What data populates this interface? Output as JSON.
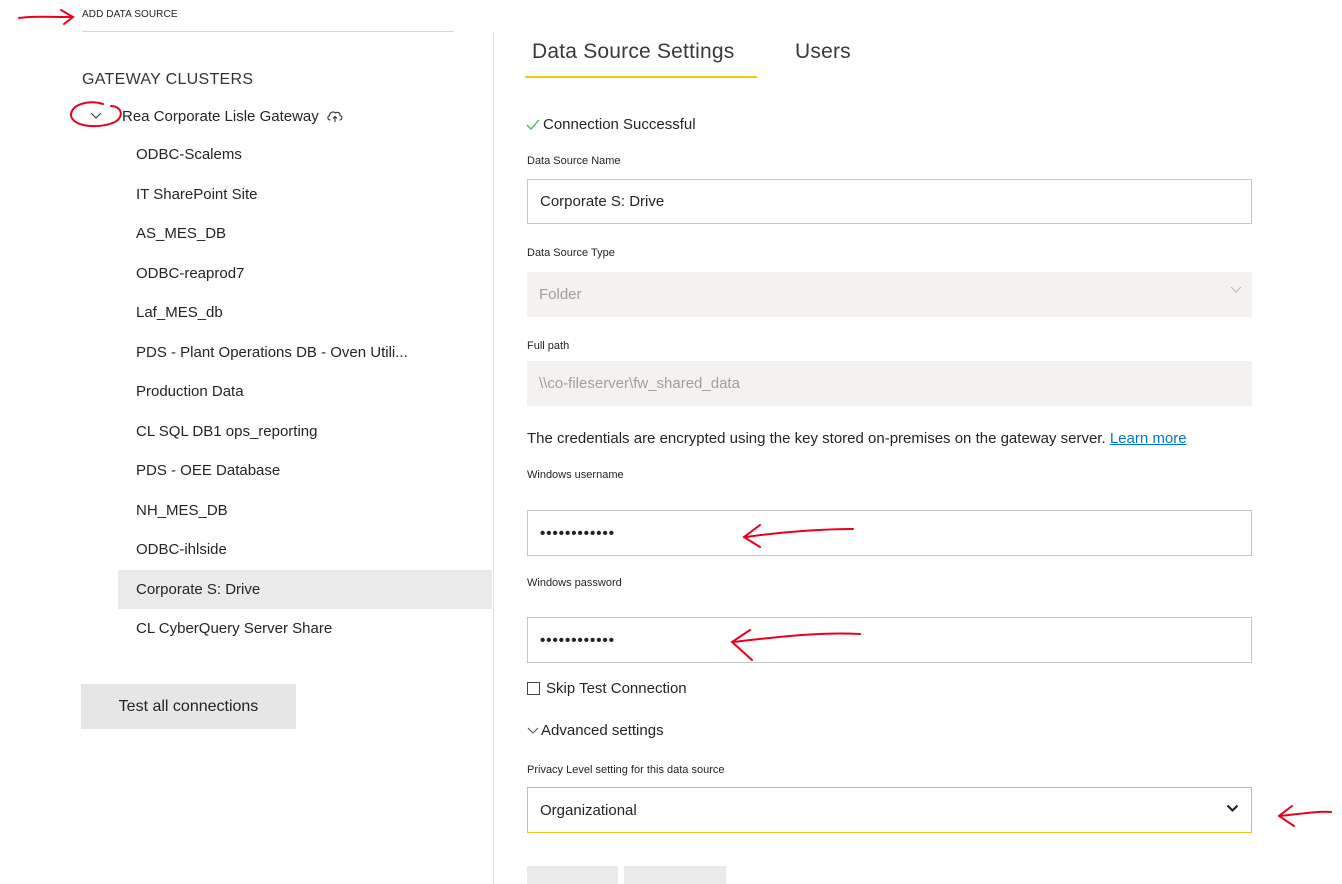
{
  "header": {
    "add_data_source": "ADD DATA SOURCE"
  },
  "sidebar": {
    "heading": "GATEWAY CLUSTERS",
    "cluster_name": "Rea Corporate Lisle Gateway",
    "items": [
      {
        "label": "ODBC-Scalems"
      },
      {
        "label": "IT SharePoint Site"
      },
      {
        "label": "AS_MES_DB"
      },
      {
        "label": "ODBC-reaprod7"
      },
      {
        "label": "Laf_MES_db"
      },
      {
        "label": "PDS - Plant Operations DB - Oven Utili..."
      },
      {
        "label": "Production Data"
      },
      {
        "label": "CL SQL DB1 ops_reporting"
      },
      {
        "label": "PDS - OEE Database"
      },
      {
        "label": "NH_MES_DB"
      },
      {
        "label": "ODBC-ihlside"
      },
      {
        "label": "Corporate S: Drive",
        "selected": true
      },
      {
        "label": "CL CyberQuery Server Share"
      }
    ],
    "test_all_label": "Test all connections"
  },
  "tabs": [
    {
      "label": "Data Source Settings",
      "active": true
    },
    {
      "label": "Users",
      "active": false
    }
  ],
  "form": {
    "connection_status": "Connection Successful",
    "ds_name_label": "Data Source Name",
    "ds_name_value": "Corporate S: Drive",
    "ds_type_label": "Data Source Type",
    "ds_type_value": "Folder",
    "full_path_label": "Full path",
    "full_path_value": "\\\\co-fileserver\\fw_shared_data",
    "credentials_note": "The credentials are encrypted using the key stored on-premises on the gateway server.",
    "learn_more": "Learn more",
    "username_label": "Windows username",
    "username_value": "••••••••••••",
    "password_label": "Windows password",
    "password_value": "••••••••••••",
    "skip_test_label": "Skip Test Connection",
    "advanced_label": "Advanced settings",
    "privacy_label": "Privacy Level setting for this data source",
    "privacy_value": "Organizational"
  },
  "colors": {
    "accent": "#f2c811",
    "success": "#4caf50",
    "link": "#0078d4",
    "annotation": "#e8001c"
  },
  "icons": [
    "chevron-down-icon",
    "cloud-upload-icon",
    "checkmark-icon",
    "dropdown-caret-icon",
    "annotation-arrow-icon"
  ]
}
